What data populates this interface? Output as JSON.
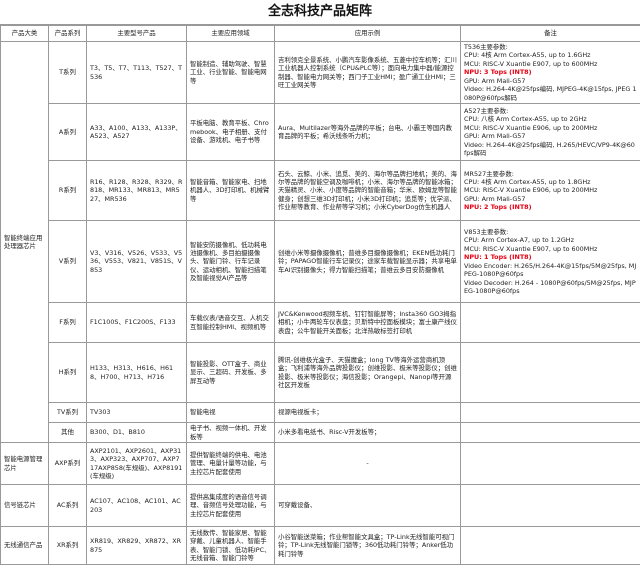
{
  "title": "全志科技产品矩阵",
  "columns": [
    "产品大类",
    "产品系列",
    "主要型号产品",
    "主要应用领域",
    "应用示例",
    "备注"
  ],
  "categories": [
    {
      "name": "智能终端应用处理器芯片"
    },
    {
      "name": "智能电源管理芯片"
    },
    {
      "name": "信号链芯片"
    },
    {
      "name": "无线通信产品"
    }
  ],
  "rows": [
    {
      "series": "T系列",
      "models": "T3、T5、T7、T113、T527、T536",
      "domain": "智能制造、辅助驾驶、智慧工业、行业智能、智能电网等",
      "examples": "吉利领克全景系统、小鹏汽车影像系统、五菱中控车机等；汇川工业机器人控制系统（CPU&PLC等）；面向电力集中器/能源控制器、智能电力网关等；西门子工业HMI；盈广通工业HMI；三旺工业网关等",
      "notes": [
        {
          "text": "T536主要参数:",
          "hl": false
        },
        {
          "text": "CPU: 4核 Arm Cortex-A55, up to 1.6GHz",
          "hl": false
        },
        {
          "text": "MCU: RISC-V Xuantie E907, up to 600MHz",
          "hl": false
        },
        {
          "text": "NPU: 3 Tops (INT8)",
          "hl": true
        },
        {
          "text": "GPU: Arm Mali-G57",
          "hl": false
        },
        {
          "text": "Video: H.264-4K@25fps编码, MJPEG-4K@15fps, JPEG 1080P@60fps解码",
          "hl": false
        }
      ]
    },
    {
      "series": "A系列",
      "models": "A33、A100、A133、A133P、A523、A527",
      "domain": "平板电脑、教育平板、Chromebook、电子相册、支付设备、游戏机、电子书等",
      "examples": "Aura、Multilazer等海外品牌的平板；台电、小霸王等国内教育品牌的平板；希沃线条听力机；",
      "notes": [
        {
          "text": "A527主要参数:",
          "hl": false
        },
        {
          "text": "CPU: 八核 Arm Cortex-A55, up to 2GHz",
          "hl": false
        },
        {
          "text": "MCU: RISC-V Xuantie E906, up to 200MHz",
          "hl": false
        },
        {
          "text": "GPU: Arm Mali-G57",
          "hl": false
        },
        {
          "text": "Video: H.264-4K@25fps编码, H.265/HEVC/VP9-4K@60fps解码",
          "hl": false
        }
      ]
    },
    {
      "series": "R系列",
      "models": "R16、R128、R328、R329、R818、MR133、MR813、MR527、MR536",
      "domain": "智能音箱、智能家电、扫地机器人、3D打印机、机械臂等",
      "examples": "石头、云鲸、小米、追觅、美的、海尔等品牌扫地机；美的、海尔等品牌的智能空调及咖啡机；小米、海尔等品牌的智能冰箱；天猫精灵、小米、小度等品牌的智能音箱；华米、欧姆龙等智能健身；创想三维3D打印机；小米3D打印机；追觅等；优学派、作业帮等教育、作业帮等学习机；小米CyberDog仿生机器人",
      "notes": [
        {
          "text": "MR527主要参数:",
          "hl": false
        },
        {
          "text": "CPU: 4核 Arm Cortex-A55, up to 1.8GHz",
          "hl": false
        },
        {
          "text": "MCU: RISC-V Xuantie E906, up to 200MHz",
          "hl": false
        },
        {
          "text": "GPU: Arm Mali-G57",
          "hl": false
        },
        {
          "text": "NPU: 2 Tops (INT8)",
          "hl": true
        }
      ]
    },
    {
      "series": "V系列",
      "models": "V3、V316、V526、V533、V536、V553、V821、V851S、V853",
      "domain": "智能安防摄像机、低功耗电池摄像机、多目拍摄摄像头、智能门铃、行车记录仪、运动相机、智能扫描笔及智能视觉AI产品等",
      "examples": "创维小米等摄像摄像机；普维多目摄像摄像机；EKEN低功耗门铃；PAPAGO智能行车记录仪；途家车载智能显示器；共享电单车AI识别摄像头；得力智能扫描笔；普维云多目安防摄像机",
      "notes": [
        {
          "text": "V853主要参数:",
          "hl": false
        },
        {
          "text": "CPU: Arm Cortex-A7, up to 1.2GHz",
          "hl": false
        },
        {
          "text": "MCU: RISC-V Xuantie E907, up to 600MHz",
          "hl": false
        },
        {
          "text": "NPU: 1 Tops (INT8)",
          "hl": true
        },
        {
          "text": "Video Encoder: H.265/H.264-4K@15fps/5M@25fps, MJPEG-1080P@60fps",
          "hl": false
        },
        {
          "text": "Video Decoder: H.264 - 1080P@60fps/5M@25fps, MJPEG-1080P@60fps",
          "hl": false
        }
      ]
    },
    {
      "series": "F系列",
      "models": "F1C100S、F1C200S、F133",
      "domain": "车载仪表/语音交互、人机交互智能控制HMI、视频机等",
      "examples": "JVC&Kenwood视频车机、钉钉智能屏等；Insta360 GO3拇指相机；小牛两轮车仪表盘；贝斯特中控面板模块；富士康产线仪表盘；公牛智能开关面板；北洋热敏标签打印机",
      "notes": []
    },
    {
      "series": "H系列",
      "models": "H133、H313、H616、H618、H700、H713、H716",
      "domain": "智能投影、OTT盒子、商业显示、三超码、开发板、多屏互动等",
      "examples": "腾讯-创维极光盒子、天猫魔盒；long TV等海外运营商机顶盒；飞利浦等海外品牌投影仪；创维投影、极米等投影仪；创维投影、极米等投影仪；海信投影；Orangepi、Nanopi等开源社区开发板",
      "notes": []
    },
    {
      "series": "TV系列",
      "models": "TV303",
      "domain": "智能电视",
      "examples": "视源电视板卡；",
      "notes": []
    },
    {
      "series": "其他",
      "models": "B300、D1、B810",
      "domain": "电子书、视频一体机、开发板等",
      "examples": "小米多看电纸书、Risc-V开发板等；",
      "notes": []
    },
    {
      "series": "AXP系列",
      "models": "AXP2101、AXP2601、AXP313、AXP323、AXP707、AXP717AXP858(车规级)、AXP8191(车规级)",
      "domain": "提供智能终端的供电、电池管理、电量计量等功能，与主控芯片配套使用",
      "examples": "-",
      "notes": []
    },
    {
      "series": "AC系列",
      "models": "AC107、AC108、AC101、AC203",
      "domain": "提供高集成度的语音信号调理、音频信号处理功能，与主控芯片配套使用",
      "examples": "可穿戴设备、",
      "notes": []
    },
    {
      "series": "XR系列",
      "models": "XR819、XR829、XR872、XR875",
      "domain": "无线数传、智能家居、智能穿戴、儿童机器人、智能手表、智能门锁、低功耗IPC、无线音箱、智能门铃等",
      "examples": "小谷智能送菜箱；作业帮智能文具盒；TP-Link无线智能可视门铃；TP-Link无线智能门锁等；360低功耗门铃等；Anker低功耗门铃等",
      "notes": []
    }
  ]
}
